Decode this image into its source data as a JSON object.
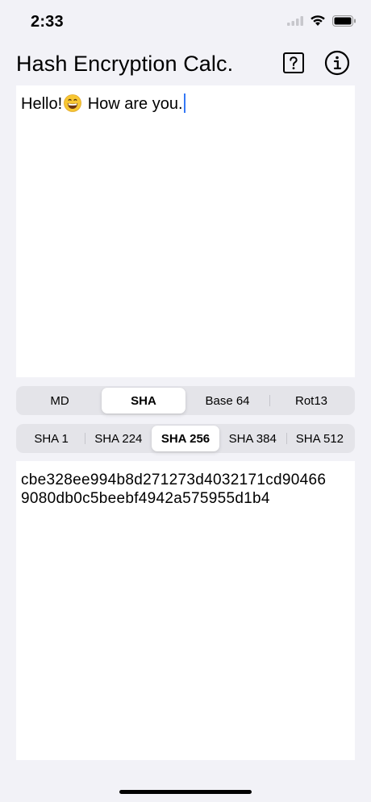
{
  "status": {
    "time": "2:33"
  },
  "header": {
    "title": "Hash Encryption Calc.",
    "help_icon": "question-square-icon",
    "info_icon": "info-circle-icon"
  },
  "input": {
    "text_before": "Hello!",
    "emoji": "grinning-face-emoji",
    "text_after": " How are you."
  },
  "algorithm_tabs": {
    "items": [
      "MD",
      "SHA",
      "Base 64",
      "Rot13"
    ],
    "selected": "SHA"
  },
  "sha_variant_tabs": {
    "items": [
      "SHA 1",
      "SHA 224",
      "SHA 256",
      "SHA 384",
      "SHA 512"
    ],
    "selected": "SHA 256"
  },
  "output": {
    "line1": "cbe328ee994b8d271273d4032171cd90466",
    "line2": "9080db0c5beebf4942a575955d1b4"
  },
  "colors": {
    "background": "#f2f2f7",
    "caret": "#3478f6"
  }
}
